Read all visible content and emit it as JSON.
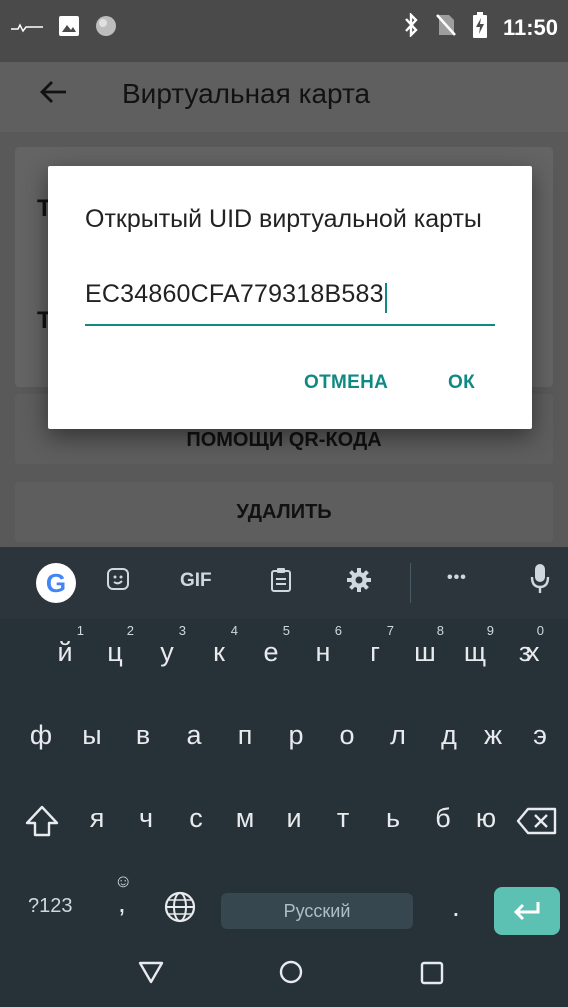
{
  "status": {
    "time": "11:50"
  },
  "appbar": {
    "title": "Виртуальная карта"
  },
  "buttons": {
    "qr_part": "ПОМОЩИ QR-КОДА",
    "delete": "УДАЛИТЬ"
  },
  "dialog": {
    "title": "Открытый UID виртуальной карты",
    "value": "EC34860CFA779318B583",
    "cancel": "ОТМЕНА",
    "ok": "ОК"
  },
  "keyboard": {
    "suggestions": {
      "gif": "GIF",
      "more": "•••"
    },
    "row1": [
      {
        "k": "й",
        "n": "1"
      },
      {
        "k": "ц",
        "n": "2"
      },
      {
        "k": "у",
        "n": "3"
      },
      {
        "k": "к",
        "n": "4"
      },
      {
        "k": "е",
        "n": "5"
      },
      {
        "k": "н",
        "n": "6"
      },
      {
        "k": "г",
        "n": "7"
      },
      {
        "k": "ш",
        "n": "8"
      },
      {
        "k": "щ",
        "n": "9"
      },
      {
        "k": "з",
        "n": "0"
      },
      {
        "k": "х",
        "n": ""
      }
    ],
    "row2": [
      "ф",
      "ы",
      "в",
      "а",
      "п",
      "р",
      "о",
      "л",
      "д",
      "ж",
      "э"
    ],
    "row3": [
      "я",
      "ч",
      "с",
      "м",
      "и",
      "т",
      "ь",
      "б",
      "ю"
    ],
    "bottom": {
      "sym": "?123",
      "comma": ",",
      "space": "Русский",
      "period": "."
    }
  },
  "colors": {
    "accent": "#0f8a83",
    "enter": "#5cc0b3"
  }
}
